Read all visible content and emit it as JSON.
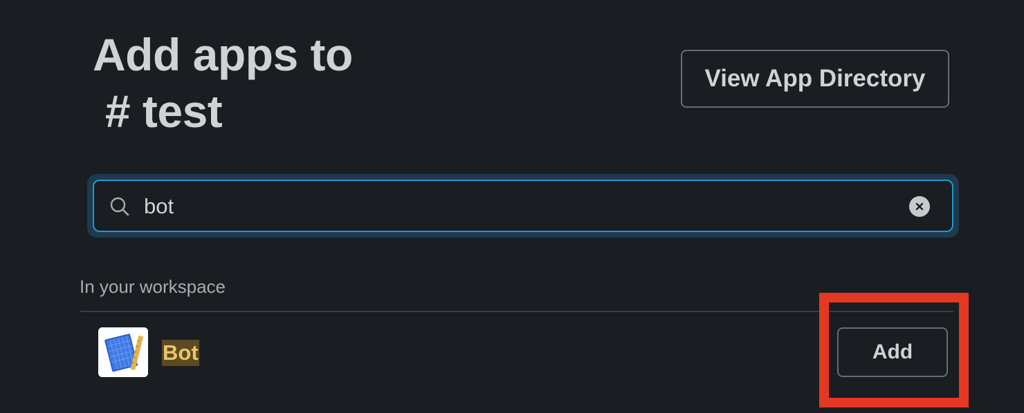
{
  "header": {
    "title_line1": "Add apps to",
    "title_line2": " # test",
    "view_directory_label": "View App Directory"
  },
  "search": {
    "value": "bot",
    "icon": "search-icon",
    "clear_icon": "clear-icon",
    "focus_color": "#1d9bd1"
  },
  "results": {
    "section_label": "In your workspace",
    "apps": [
      {
        "name": "Bot",
        "icon": "bot-app-icon",
        "add_label": "Add"
      }
    ]
  },
  "colors": {
    "background": "#1a1d21",
    "text": "#d1d2d3",
    "match_highlight": "#e8c66a",
    "annotation": "#e53822"
  }
}
